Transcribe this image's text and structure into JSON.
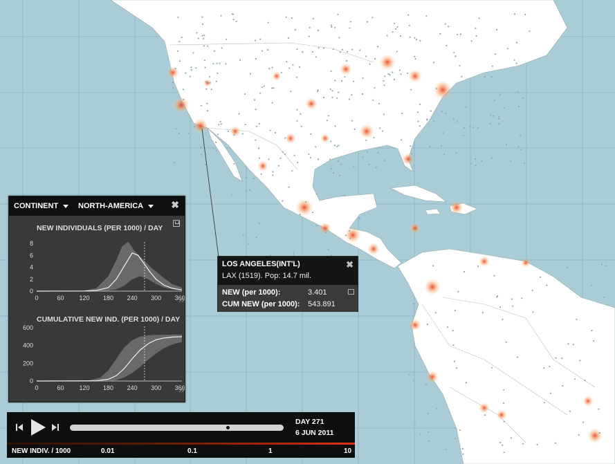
{
  "panel": {
    "dropdown_scope": "CONTINENT",
    "dropdown_region": "NORTH-AMERICA",
    "close_label": "✖"
  },
  "chart_data": [
    {
      "type": "line",
      "title": "NEW INDIVIDUALS (PER 1000) / DAY",
      "xlim": [
        0,
        365
      ],
      "ylim": [
        0,
        8
      ],
      "x_ticks": [
        "0",
        "60",
        "120",
        "180",
        "240",
        "300",
        "360"
      ],
      "y_ticks": [
        "0",
        "2",
        "4",
        "6",
        "8"
      ],
      "current_day": 271,
      "series": [
        {
          "role": "median",
          "x": [
            0,
            120,
            150,
            180,
            200,
            220,
            240,
            255,
            270,
            285,
            300,
            320,
            340,
            365
          ],
          "y": [
            0,
            0.02,
            0.1,
            0.6,
            2.0,
            4.2,
            6.4,
            6.0,
            4.6,
            3.2,
            2.0,
            1.0,
            0.5,
            0.2
          ]
        },
        {
          "role": "band-upper",
          "x": [
            0,
            120,
            150,
            180,
            200,
            215,
            230,
            245,
            260,
            275,
            290,
            305,
            320,
            340,
            365
          ],
          "y": [
            0,
            0.1,
            0.5,
            2.5,
            5.2,
            7.5,
            8.3,
            6.8,
            5.8,
            4.8,
            3.8,
            3.0,
            2.2,
            1.2,
            0.6
          ]
        },
        {
          "role": "band-lower",
          "x": [
            0,
            150,
            180,
            200,
            220,
            240,
            260,
            280,
            300,
            320,
            340,
            365
          ],
          "y": [
            0,
            0.0,
            0.1,
            0.3,
            0.9,
            2.0,
            2.5,
            2.0,
            1.2,
            0.6,
            0.3,
            0.1
          ]
        }
      ]
    },
    {
      "type": "area",
      "title": "CUMULATIVE NEW IND. (PER 1000) / DAY",
      "xlim": [
        0,
        365
      ],
      "ylim": [
        0,
        600
      ],
      "x_ticks": [
        "0",
        "60",
        "120",
        "180",
        "240",
        "300",
        "360"
      ],
      "y_ticks": [
        "0",
        "200",
        "400",
        "600"
      ],
      "current_day": 271,
      "series": [
        {
          "role": "median",
          "x": [
            0,
            150,
            180,
            200,
            220,
            240,
            260,
            280,
            300,
            320,
            340,
            365
          ],
          "y": [
            0,
            2,
            20,
            60,
            140,
            250,
            350,
            420,
            465,
            485,
            495,
            500
          ]
        },
        {
          "role": "band-upper",
          "x": [
            0,
            130,
            160,
            180,
            200,
            220,
            240,
            260,
            280,
            300,
            330,
            365
          ],
          "y": [
            0,
            5,
            40,
            120,
            250,
            380,
            460,
            500,
            515,
            520,
            522,
            525
          ]
        },
        {
          "role": "band-lower",
          "x": [
            0,
            180,
            200,
            220,
            240,
            260,
            280,
            300,
            320,
            340,
            365
          ],
          "y": [
            0,
            0,
            10,
            40,
            90,
            160,
            240,
            310,
            370,
            410,
            440
          ]
        }
      ]
    }
  ],
  "tooltip": {
    "title": "LOS ANGELES(INT'L)",
    "subtitle": "LAX (1519). Pop: 14.7 mil.",
    "close_label": "✖",
    "new_label": "NEW (per 1000):",
    "new_value": "3.401",
    "cum_label": "CUM NEW (per 1000):",
    "cum_value": "543.891"
  },
  "player": {
    "day": "DAY 271",
    "date": "6 JUN 2011",
    "progress": 0.74,
    "legend_title": "NEW INDIV. / 1000",
    "legend_ticks": [
      "0.01",
      "0.1",
      "1",
      "10"
    ]
  },
  "colors": {
    "ocean": "#a9ccd6",
    "land": "#ffffff",
    "hotspot": "#f07a3a",
    "accent": "#e53215"
  }
}
